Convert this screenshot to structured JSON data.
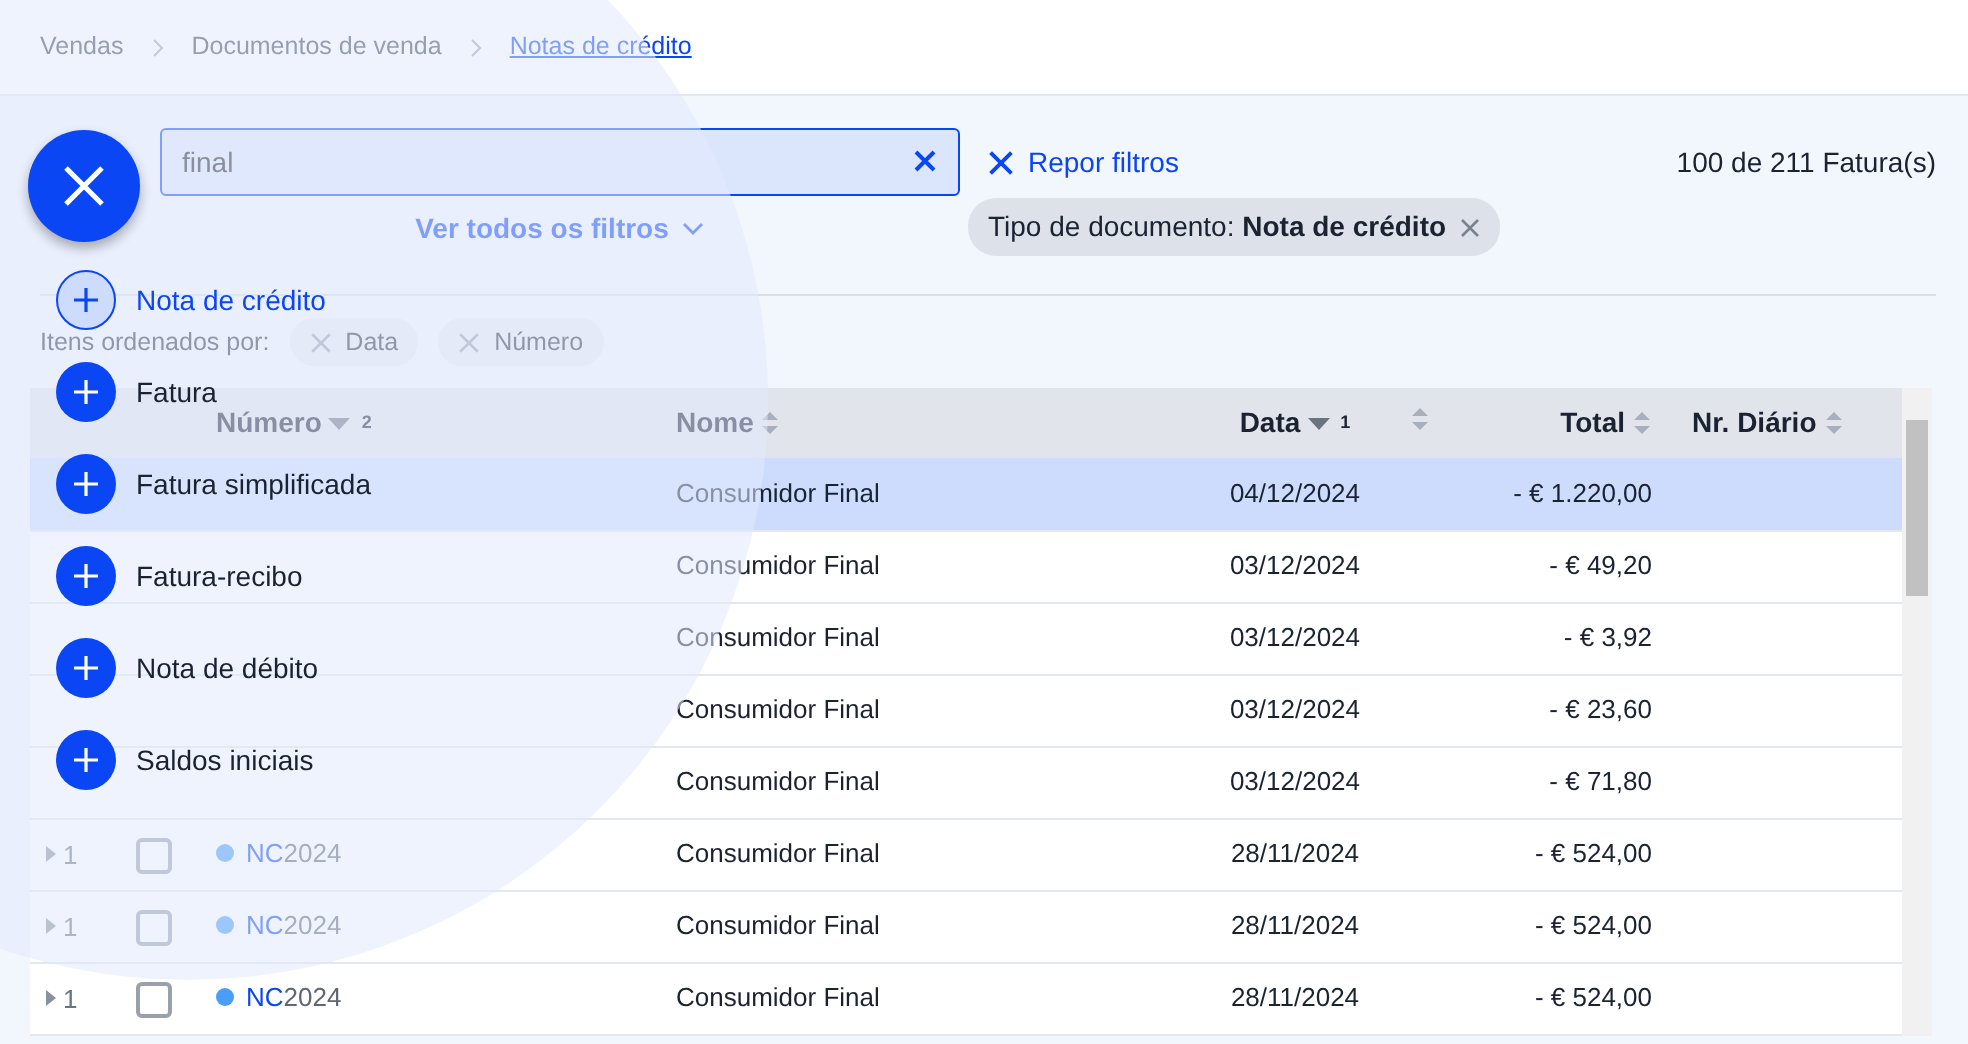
{
  "breadcrumb": [
    {
      "label": "Vendas",
      "selected": false
    },
    {
      "label": "Documentos de venda",
      "selected": false
    },
    {
      "label": "Notas de crédito",
      "selected": true
    }
  ],
  "search": {
    "value": "final"
  },
  "filters_toggle": "Ver todos os filtros",
  "reset_filters": "Repor filtros",
  "result_count": "100 de 211 Fatura(s)",
  "active_filters": [
    {
      "label": "Tipo de documento:",
      "value": "Nota de crédito"
    }
  ],
  "sort": {
    "label": "Itens ordenados por:",
    "chips": [
      "Data",
      "Número"
    ]
  },
  "table": {
    "columns": [
      {
        "kind": "expand"
      },
      {
        "kind": "check"
      },
      {
        "kind": "sorted",
        "label": "Número",
        "order": "2"
      },
      {
        "kind": "sortable",
        "label": "Nome"
      },
      {
        "kind": "sorted",
        "label": "Data",
        "order": "1"
      },
      {
        "kind": "sortable"
      },
      {
        "kind": "sortable",
        "label": "Total"
      },
      {
        "kind": "sortable",
        "label": "Nr. Diário"
      }
    ],
    "rows": [
      {
        "name": "Consumidor Final",
        "date": "04/12/2024",
        "total": "- € 1.220,00",
        "selected": true
      },
      {
        "name": "Consumidor Final",
        "date": "03/12/2024",
        "total": "- € 49,20",
        "selected": false
      },
      {
        "name": "Consumidor Final",
        "date": "03/12/2024",
        "total": "- € 3,92",
        "selected": false
      },
      {
        "name": "Consumidor Final",
        "date": "03/12/2024",
        "total": "- € 23,60",
        "selected": false
      },
      {
        "name": "Consumidor Final",
        "date": "03/12/2024",
        "total": "- € 71,80",
        "selected": false
      },
      {
        "expand_count": "1",
        "checked": false,
        "number_prefix": "NC",
        "number_suffix": "2024",
        "name": "Consumidor Final",
        "date": "28/11/2024",
        "total": "- € 524,00",
        "selected": false
      },
      {
        "expand_count": "1",
        "checked": false,
        "number_prefix": "NC",
        "number_suffix": "2024",
        "name": "Consumidor Final",
        "date": "28/11/2024",
        "total": "- € 524,00",
        "selected": false
      },
      {
        "expand_count": "1",
        "checked": false,
        "number_prefix": "NC",
        "number_suffix": "2024",
        "name": "Consumidor Final",
        "date": "28/11/2024",
        "total": "- € 524,00",
        "selected": false
      }
    ]
  },
  "new_menu": {
    "open": true,
    "items": [
      {
        "label": "Nota de crédito",
        "selected": true
      },
      {
        "label": "Fatura",
        "selected": false
      },
      {
        "label": "Fatura simplificada",
        "selected": false
      },
      {
        "label": "Fatura-recibo",
        "selected": false
      },
      {
        "label": "Nota de débito",
        "selected": false
      },
      {
        "label": "Saldos iniciais",
        "selected": false
      }
    ]
  }
}
